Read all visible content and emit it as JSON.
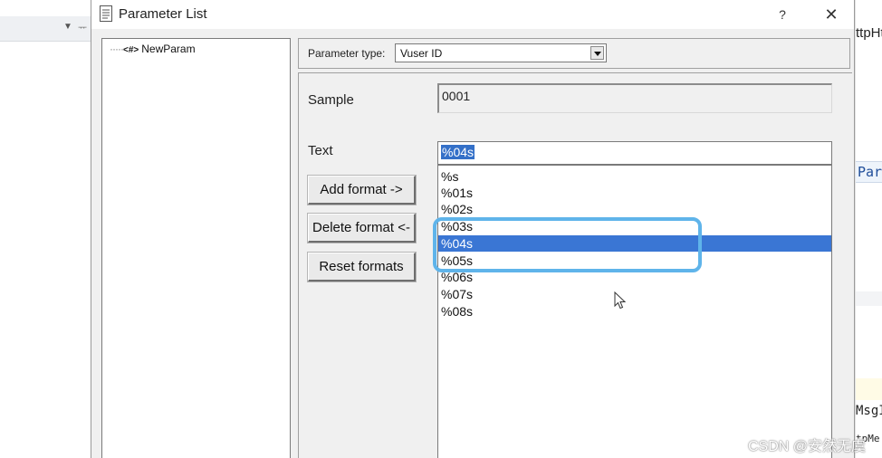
{
  "dialog": {
    "title": "Parameter List",
    "help_label": "?",
    "close_label": "✕"
  },
  "tree": {
    "items": [
      {
        "tag": "<#>",
        "label": "NewParam"
      }
    ]
  },
  "parameter_type": {
    "label": "Parameter type:",
    "value": "Vuser ID"
  },
  "sample": {
    "label": "Sample",
    "value": "0001"
  },
  "text": {
    "label": "Text",
    "value": "%04s"
  },
  "buttons": {
    "add_format": "Add format ->",
    "delete_format": "Delete format <-",
    "reset_formats": "Reset formats"
  },
  "format_list": {
    "items": [
      "%s",
      "%01s",
      "%02s",
      "%03s",
      "%04s",
      "%05s",
      "%06s",
      "%07s",
      "%08s"
    ],
    "selected": "%04s"
  },
  "background": {
    "right_fragment_top": "ttpHt",
    "right_fragment_mid": "Par",
    "right_fragment_bottom": "MsgI",
    "right_fragment_last": "tpMe"
  },
  "watermark": "CSDN @安然无虞",
  "colors": {
    "selection": "#3a76d4",
    "annotation": "#5fb4ea",
    "dialog_bg": "#f0f0f0"
  }
}
